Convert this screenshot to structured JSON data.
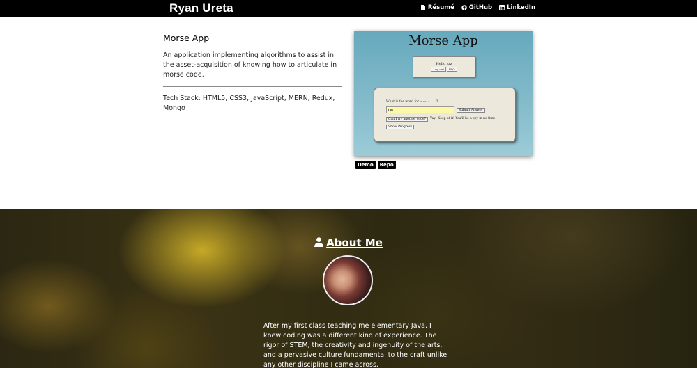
{
  "nav": {
    "brand": "Ryan Ureta",
    "links": [
      {
        "label": "Résumé",
        "icon": "file-icon"
      },
      {
        "label": "GitHub",
        "icon": "github-icon"
      },
      {
        "label": "LinkedIn",
        "icon": "linkedin-icon"
      }
    ]
  },
  "project": {
    "title": "Morse App",
    "description": "An application implementing algorithms to assist in the asset-acquisition of knowing how to articulate in morse code.",
    "tech_stack": "Tech Stack: HTML5, CSS3, JavaScript, MERN, Redux, Mongo",
    "buttons": {
      "demo": "Demo",
      "repo": "Repo"
    },
    "screenshot": {
      "title": "Morse App",
      "hello": "Hello zzz",
      "logout": "Log out",
      "faq": "FAQ",
      "question": "What is the word for -- --- .-. ... .?",
      "answer_value": "Qo",
      "submit": "Submit Answer",
      "another": "Can I try another code?",
      "message": "Yay! Keep at it! You'll be a spy in no time!",
      "progress": "Show Progress"
    }
  },
  "about": {
    "heading": "About Me",
    "text": "After my first class teaching me elementary Java, I knew coding was a different kind of experience. The rigor of STEM, the creativity and ingenuity of the arts, and a pervasive culture fundamental to the craft unlike any other discipline I came across."
  }
}
